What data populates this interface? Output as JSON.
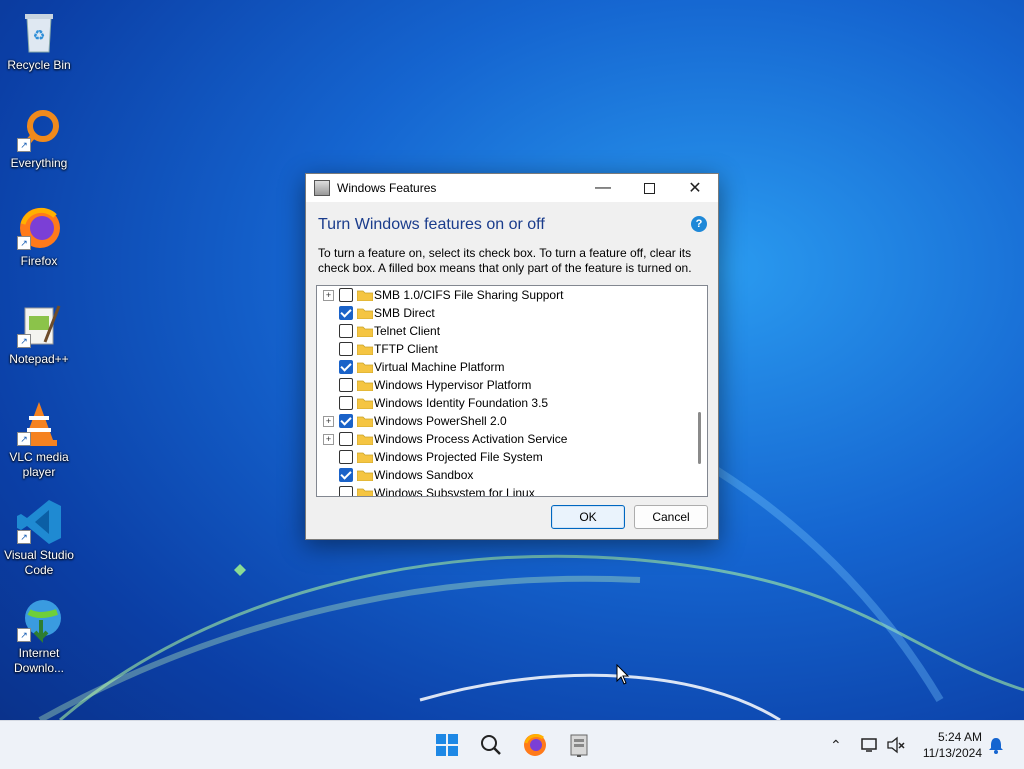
{
  "desktop": {
    "icons": [
      {
        "label": "Recycle Bin"
      },
      {
        "label": "Everything"
      },
      {
        "label": "Firefox"
      },
      {
        "label": "Notepad++"
      },
      {
        "label": "VLC media player"
      },
      {
        "label": "Visual Studio Code"
      },
      {
        "label": "Internet Downlo..."
      }
    ]
  },
  "dialog": {
    "title": "Windows Features",
    "heading": "Turn Windows features on or off",
    "help_glyph": "?",
    "description": "To turn a feature on, select its check box. To turn a feature off, clear its check box. A filled box means that only part of the feature is turned on.",
    "features": [
      {
        "label": "SMB 1.0/CIFS File Sharing Support",
        "checked": false,
        "expandable": true
      },
      {
        "label": "SMB Direct",
        "checked": true,
        "expandable": false
      },
      {
        "label": "Telnet Client",
        "checked": false,
        "expandable": false
      },
      {
        "label": "TFTP Client",
        "checked": false,
        "expandable": false
      },
      {
        "label": "Virtual Machine Platform",
        "checked": true,
        "expandable": false
      },
      {
        "label": "Windows Hypervisor Platform",
        "checked": false,
        "expandable": false
      },
      {
        "label": "Windows Identity Foundation 3.5",
        "checked": false,
        "expandable": false
      },
      {
        "label": "Windows PowerShell 2.0",
        "checked": true,
        "expandable": true
      },
      {
        "label": "Windows Process Activation Service",
        "checked": false,
        "expandable": true
      },
      {
        "label": "Windows Projected File System",
        "checked": false,
        "expandable": false
      },
      {
        "label": "Windows Sandbox",
        "checked": true,
        "expandable": false
      },
      {
        "label": "Windows Subsystem for Linux",
        "checked": false,
        "expandable": false
      }
    ],
    "ok_label": "OK",
    "cancel_label": "Cancel"
  },
  "taskbar": {
    "apps": [
      "start-icon",
      "search-icon",
      "firefox-icon",
      "windows-features-icon"
    ],
    "tray": {
      "time": "5:24 AM",
      "date": "11/13/2024"
    }
  },
  "colors": {
    "accent": "#1a62c8",
    "heading": "#1a3c8c",
    "folder": "#f5c542"
  }
}
